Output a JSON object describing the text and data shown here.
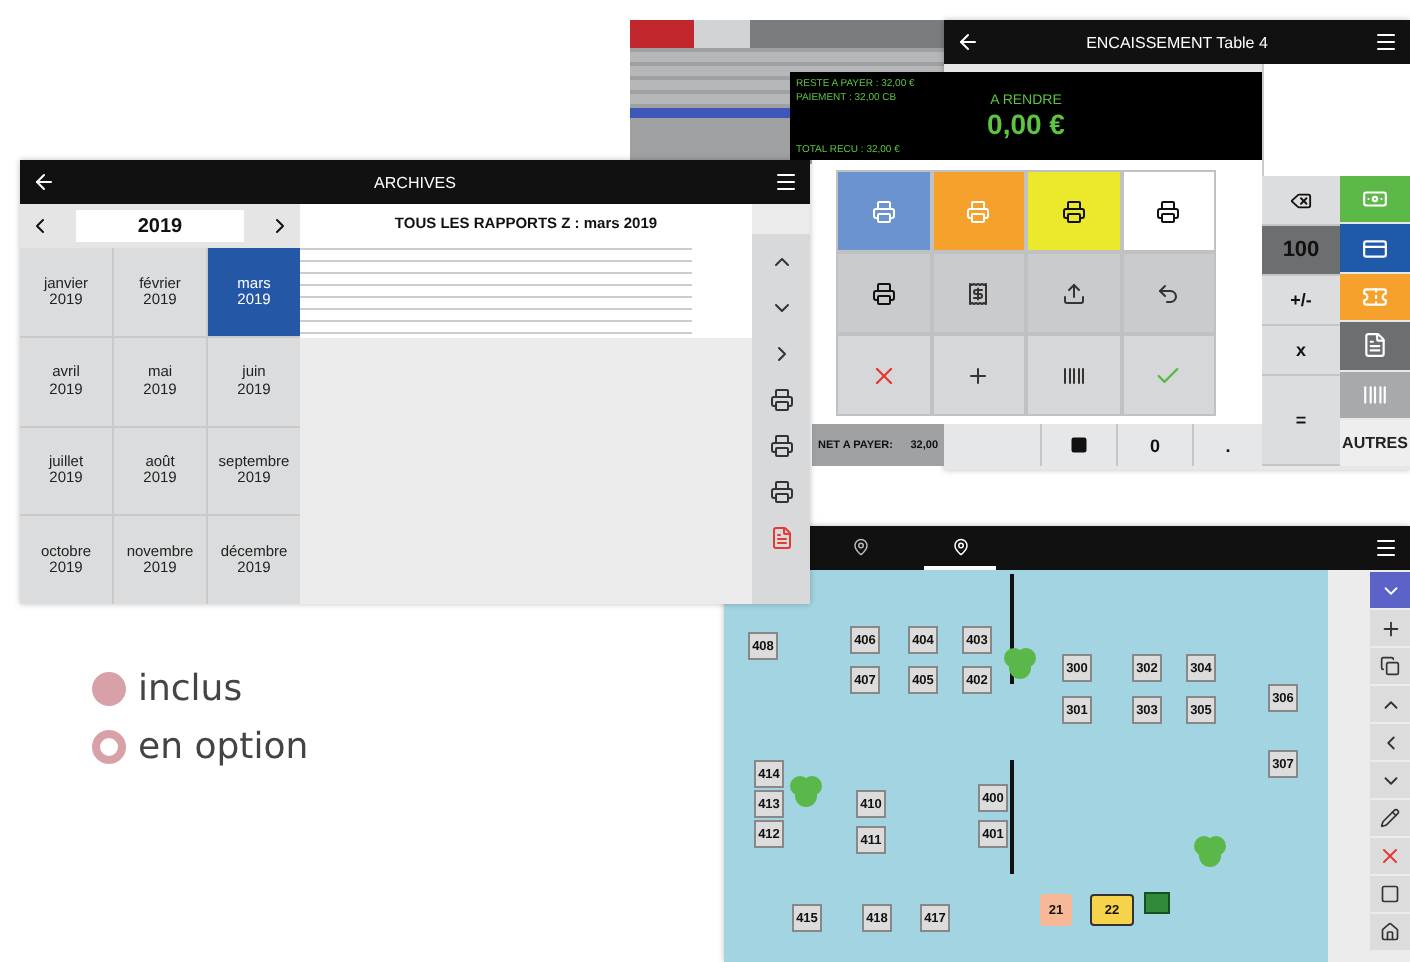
{
  "payment_window": {
    "title": "ENCAISSEMENT Table 4",
    "remaining": "RESTE A PAYER : 32,00 €",
    "payment": "PAIEMENT : 32,00 CB",
    "change_label": "A RENDRE",
    "change_amount": "0,00 €",
    "total_received": "TOTAL RECU : 32,00 €",
    "tiles": [
      {
        "kind": "printer",
        "color": "#6b93d0"
      },
      {
        "kind": "printer",
        "color": "#f5a12b"
      },
      {
        "kind": "printer",
        "color": "#ece92c"
      },
      {
        "kind": "printer",
        "color": "#ffffff"
      },
      {
        "kind": "printer",
        "color": "#c9cbcd"
      },
      {
        "kind": "receipt",
        "color": "#c9cbcd"
      },
      {
        "kind": "upload",
        "color": "#c9cbcd"
      },
      {
        "kind": "undo",
        "color": "#c9cbcd"
      },
      {
        "kind": "cancel",
        "color": "#d5d7d8"
      },
      {
        "kind": "add",
        "color": "#d5d7d8"
      },
      {
        "kind": "barcode",
        "color": "#d5d7d8"
      },
      {
        "kind": "validate",
        "color": "#d5d7d8"
      }
    ],
    "keypad": [
      {
        "kind": "backspace"
      },
      {
        "kind": "dark",
        "label": "100"
      },
      {
        "kind": "light",
        "label": "+/-"
      },
      {
        "kind": "light",
        "label": "x"
      },
      {
        "kind": "tall",
        "label": "="
      }
    ],
    "methods": [
      {
        "kind": "cash",
        "color": "#5cb947"
      },
      {
        "kind": "card",
        "color": "#1f5aa8"
      },
      {
        "kind": "voucher",
        "color": "#f5a12b"
      },
      {
        "kind": "cheque",
        "color": "#6d6e70"
      },
      {
        "kind": "barcode",
        "color": "#a7a9ab"
      }
    ],
    "net_label": "NET A PAYER:",
    "net_amount": "32,00",
    "zero_key": "0",
    "dot_key": ".",
    "other_button": "AUTRES"
  },
  "floor_plan": {
    "tabs": [
      {
        "selected": false
      },
      {
        "selected": true
      }
    ],
    "tables": [
      {
        "number": "408",
        "kind": "table"
      },
      {
        "number": "406",
        "kind": "table"
      },
      {
        "number": "404",
        "kind": "table"
      },
      {
        "number": "403",
        "kind": "table"
      },
      {
        "number": "407",
        "kind": "table"
      },
      {
        "number": "405",
        "kind": "table"
      },
      {
        "number": "402",
        "kind": "table"
      },
      {
        "number": "300",
        "kind": "table"
      },
      {
        "number": "302",
        "kind": "table"
      },
      {
        "number": "304",
        "kind": "table"
      },
      {
        "number": "301",
        "kind": "table"
      },
      {
        "number": "303",
        "kind": "table"
      },
      {
        "number": "305",
        "kind": "table"
      },
      {
        "number": "306",
        "kind": "table"
      },
      {
        "number": "307",
        "kind": "table"
      },
      {
        "number": "414",
        "kind": "table"
      },
      {
        "number": "413",
        "kind": "table"
      },
      {
        "number": "412",
        "kind": "table"
      },
      {
        "number": "410",
        "kind": "table"
      },
      {
        "number": "411",
        "kind": "table"
      },
      {
        "number": "400",
        "kind": "table"
      },
      {
        "number": "401",
        "kind": "table"
      },
      {
        "number": "415",
        "kind": "table"
      },
      {
        "number": "418",
        "kind": "table"
      },
      {
        "number": "417",
        "kind": "table"
      },
      {
        "number": "21",
        "kind": "bag"
      },
      {
        "number": "22",
        "kind": "cart"
      }
    ]
  },
  "archives_window": {
    "title": "ARCHIVES",
    "year": "2019",
    "months": [
      {
        "name": "janvier",
        "year": "2019",
        "selected": false
      },
      {
        "name": "février",
        "year": "2019",
        "selected": false
      },
      {
        "name": "mars",
        "year": "2019",
        "selected": true
      },
      {
        "name": "avril",
        "year": "2019",
        "selected": false
      },
      {
        "name": "mai",
        "year": "2019",
        "selected": false
      },
      {
        "name": "juin",
        "year": "2019",
        "selected": false
      },
      {
        "name": "juillet",
        "year": "2019",
        "selected": false
      },
      {
        "name": "août",
        "year": "2019",
        "selected": false
      },
      {
        "name": "septembre",
        "year": "2019",
        "selected": false
      },
      {
        "name": "octobre",
        "year": "2019",
        "selected": false
      },
      {
        "name": "novembre",
        "year": "2019",
        "selected": false
      },
      {
        "name": "décembre",
        "year": "2019",
        "selected": false
      }
    ],
    "report_title": "TOUS LES RAPPORTS Z : mars 2019"
  },
  "legend": [
    {
      "label": "inclus",
      "kind": "filled"
    },
    {
      "label": "en option",
      "kind": "ring"
    }
  ]
}
